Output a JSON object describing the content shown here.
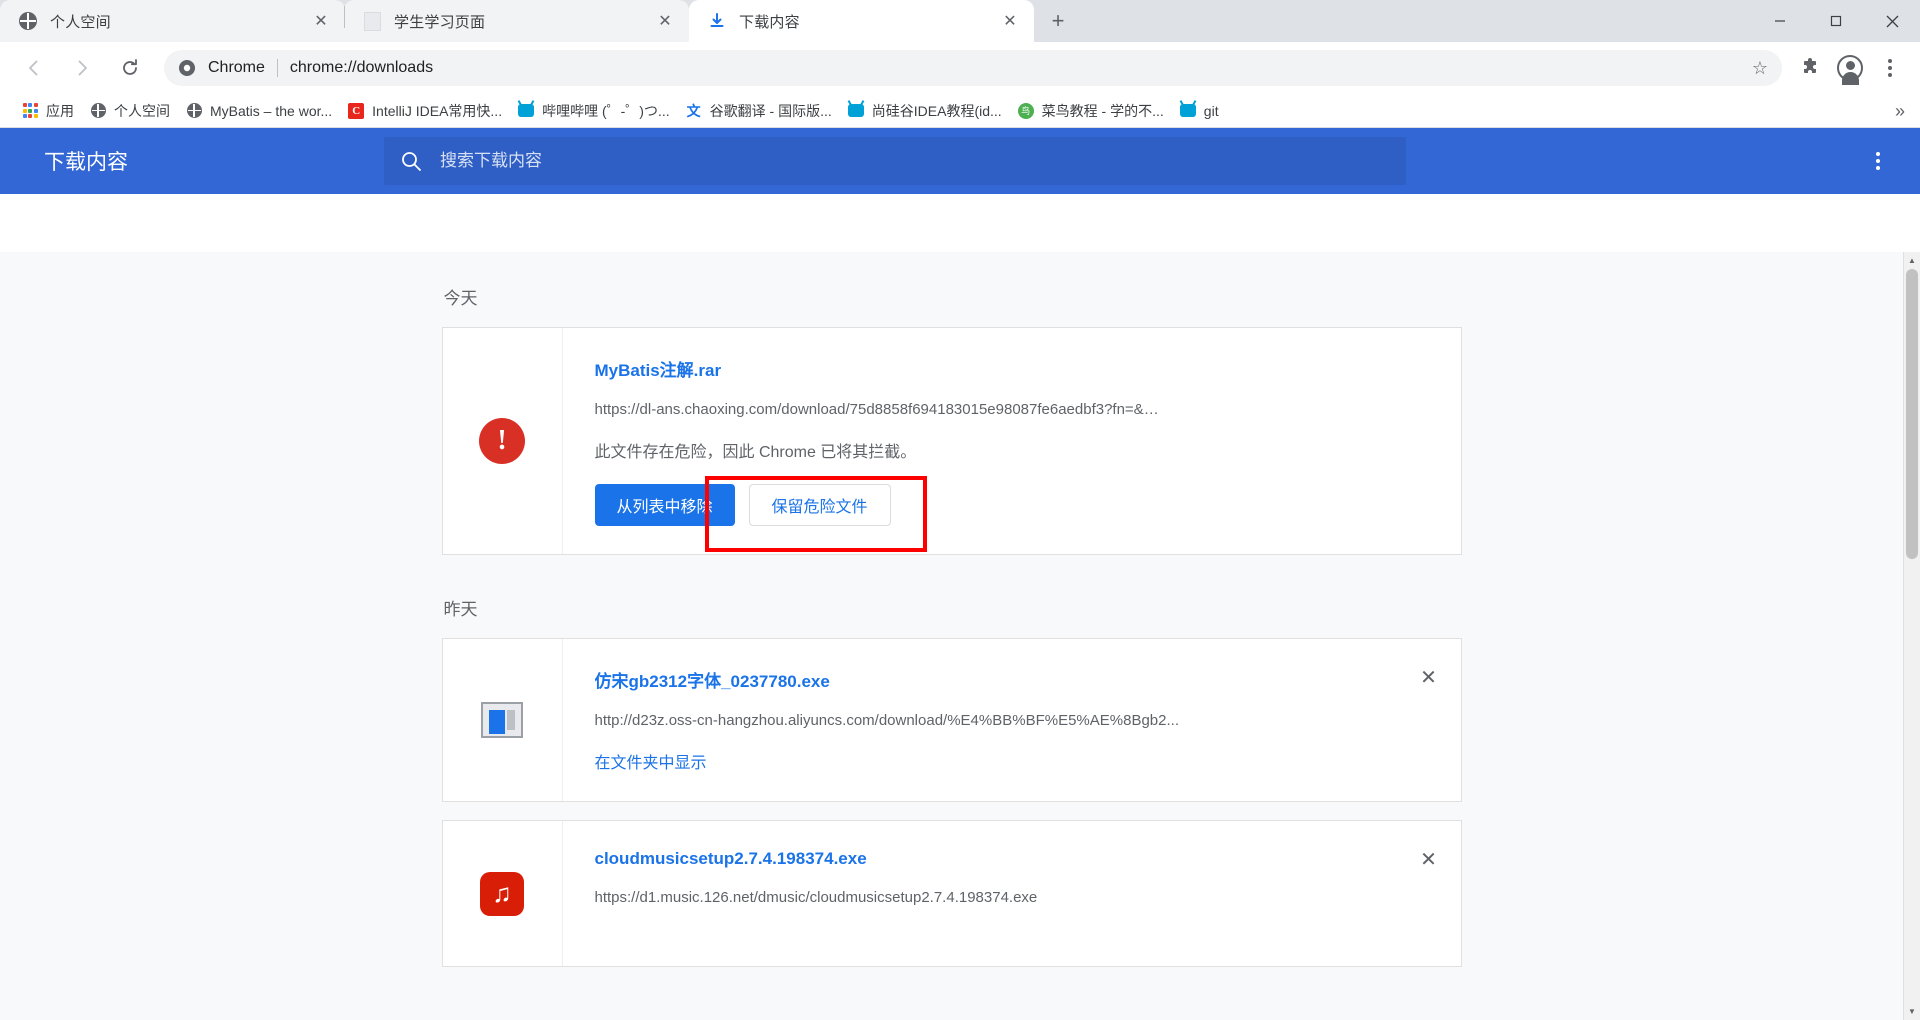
{
  "window": {
    "controls": {
      "minimize_label": "—",
      "maximize_label": "❐",
      "close_label": "✕"
    }
  },
  "tabstrip": {
    "tabs": [
      {
        "title": "个人空间",
        "favicon": "globe-icon",
        "active": false,
        "close_label": "✕"
      },
      {
        "title": "学生学习页面",
        "favicon": "blank-page-icon",
        "active": false,
        "close_label": "✕"
      },
      {
        "title": "下载内容",
        "favicon": "download-icon",
        "active": true,
        "close_label": "✕"
      }
    ],
    "new_tab_label": "+"
  },
  "toolbar": {
    "back_label": "←",
    "forward_label": "→",
    "reload_label": "⟳",
    "omnibox": {
      "scheme_label": "Chrome",
      "url": "chrome://downloads",
      "star_label": "☆"
    },
    "extensions_label": "🧩",
    "profile_label": "profile-avatar",
    "menu_label": "⋮"
  },
  "bookmarks": {
    "items": [
      {
        "label": "应用",
        "icon": "apps-grid-icon"
      },
      {
        "label": "个人空间",
        "icon": "globe-icon"
      },
      {
        "label": "MyBatis – the wor...",
        "icon": "globe-icon"
      },
      {
        "label": "IntelliJ IDEA常用快...",
        "icon": "intellij-idea-icon"
      },
      {
        "label": "哔哩哔哩 (゜-゜)つ...",
        "icon": "bilibili-icon"
      },
      {
        "label": "谷歌翻译 - 国际版...",
        "icon": "google-translate-icon"
      },
      {
        "label": "尚硅谷IDEA教程(id...",
        "icon": "bilibili-icon"
      },
      {
        "label": "菜鸟教程 - 学的不...",
        "icon": "runoob-icon"
      },
      {
        "label": "git",
        "icon": "bilibili-icon"
      }
    ],
    "overflow_label": "»"
  },
  "downloads_page": {
    "title": "下载内容",
    "search": {
      "placeholder": "搜索下载内容",
      "value": "",
      "icon": "search-icon"
    },
    "more_menu_label": "more-vertical-icon",
    "groups": [
      {
        "day_label": "今天",
        "items": [
          {
            "icon": "danger-warning-icon",
            "icon_glyph": "!",
            "filename": "MyBatis注解.rar",
            "url": "https://dl-ans.chaoxing.com/download/75d8858f694183015e98087fe6aedbf3?fn=&…",
            "status": "此文件存在危险，因此 Chrome 已将其拦截。",
            "actions": [
              {
                "label": "从列表中移除",
                "style": "primary"
              },
              {
                "label": "保留危险文件",
                "style": "outline",
                "highlighted": true
              }
            ],
            "has_close": false
          }
        ]
      },
      {
        "day_label": "昨天",
        "items": [
          {
            "icon": "generic-exe-file-icon",
            "filename": "仿宋gb2312字体_0237780.exe",
            "url": "http://d23z.oss-cn-hangzhou.aliyuncs.com/download/%E4%BB%BF%E5%AE%8Bgb2...",
            "link_action": "在文件夹中显示",
            "close_label": "✕",
            "has_close": true
          },
          {
            "icon": "netease-cloudmusic-icon",
            "icon_glyph": "♫",
            "filename": "cloudmusicsetup2.7.4.198374.exe",
            "url": "https://d1.music.126.net/dmusic/cloudmusicsetup2.7.4.198374.exe",
            "close_label": "✕",
            "has_close": true
          }
        ]
      }
    ]
  },
  "colors": {
    "header_blue": "#3367d6",
    "link_blue": "#1a73e8",
    "danger_red": "#d93025",
    "highlight_red": "#ff0000"
  }
}
